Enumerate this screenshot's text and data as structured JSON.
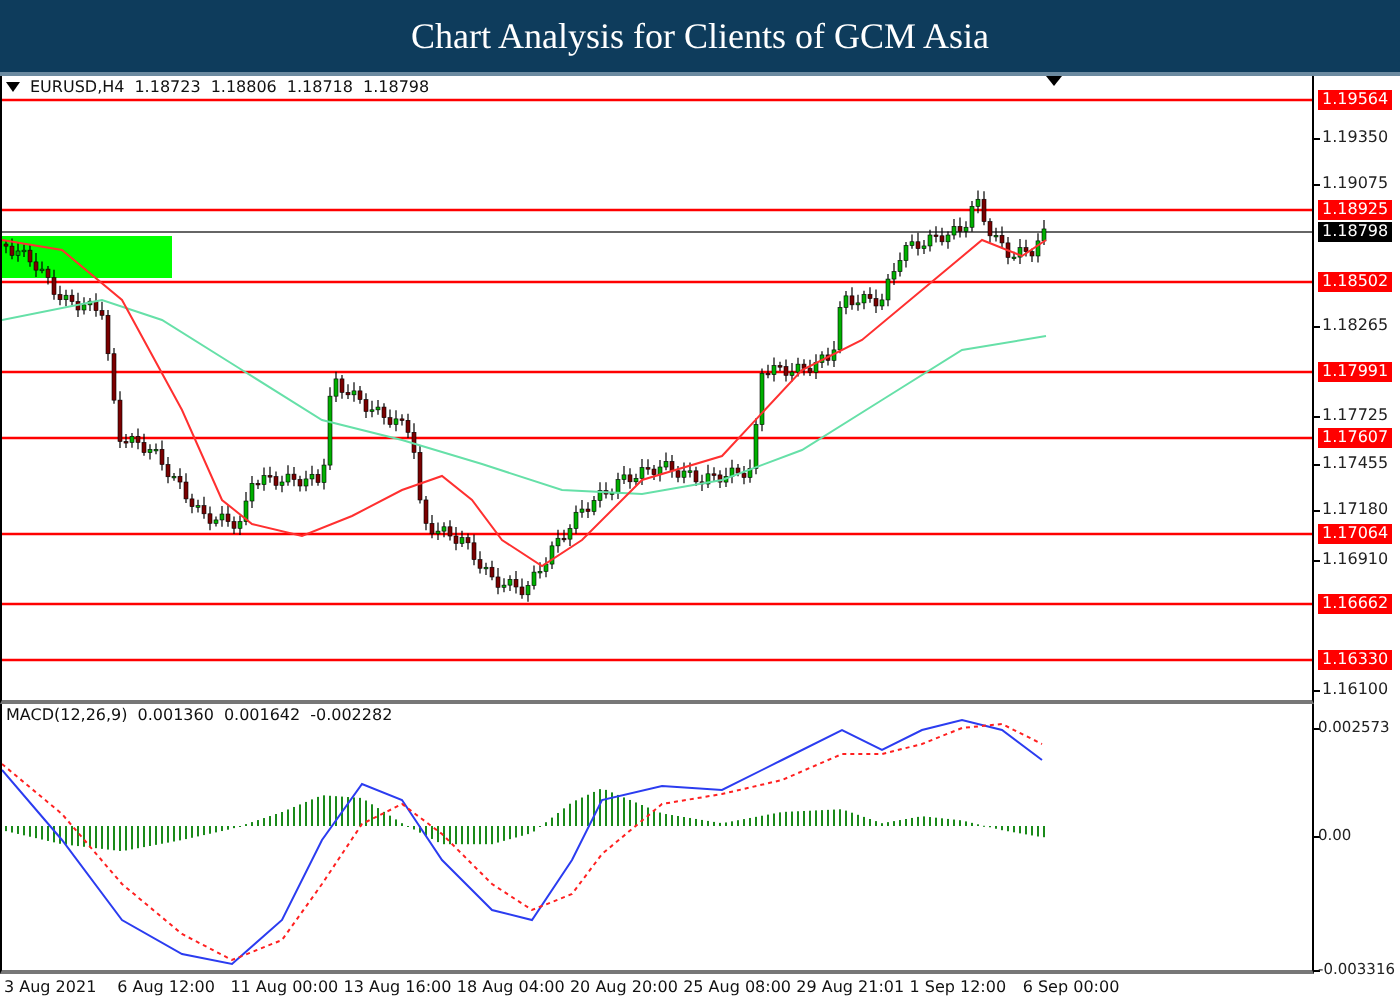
{
  "title": "Chart Analysis for Clients of GCM Asia",
  "chart": {
    "symbol": "EURUSD,H4",
    "ohlc": [
      "1.18723",
      "1.18806",
      "1.18718",
      "1.18798"
    ],
    "price_ticks": [
      "1.19350",
      "1.19075",
      "1.18265",
      "1.17725",
      "1.17455",
      "1.17180",
      "1.16910",
      "1.16100"
    ],
    "levels": [
      "1.19564",
      "1.18925",
      "1.18502",
      "1.17991",
      "1.17607",
      "1.17064",
      "1.16662",
      "1.16330"
    ],
    "current_price": "1.18798"
  },
  "macd": {
    "label": "MACD(12,26,9)",
    "values": [
      "0.001360",
      "0.001642",
      "-0.002282"
    ],
    "ticks": [
      "0.002573",
      "0.00",
      "-0.003316"
    ]
  },
  "time_axis": [
    "3 Aug 2021",
    "6 Aug 12:00",
    "11 Aug 00:00",
    "13 Aug 16:00",
    "18 Aug 04:00",
    "20 Aug 20:00",
    "25 Aug 08:00",
    "29 Aug 21:01",
    "1 Sep 12:00",
    "6 Sep 00:00"
  ]
}
